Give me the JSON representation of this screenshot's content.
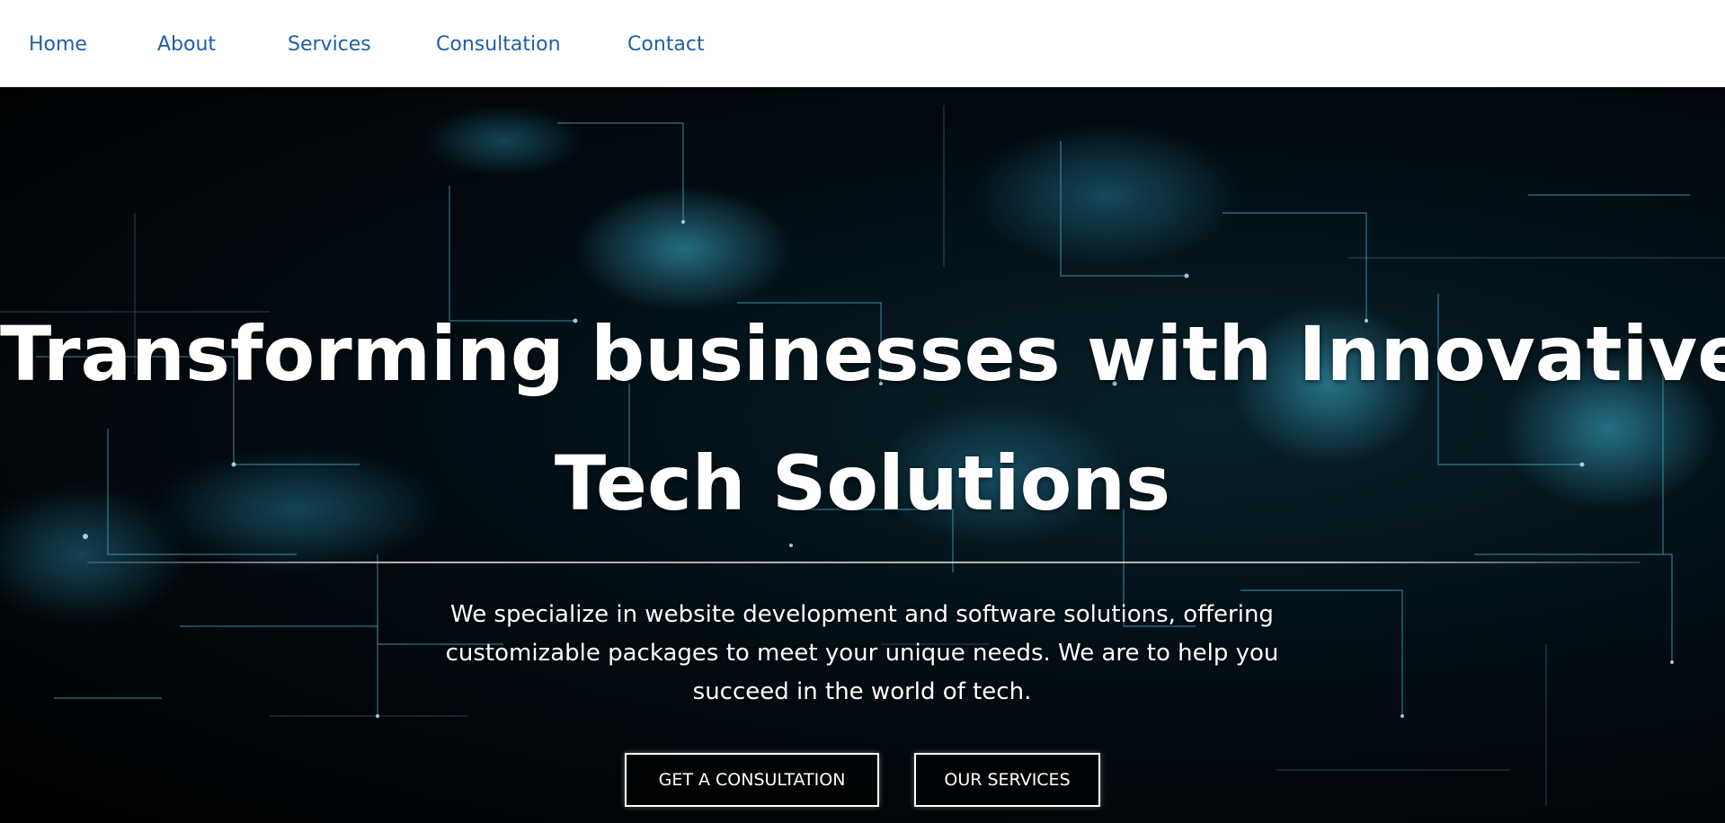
{
  "nav": {
    "items": [
      {
        "label": "Home"
      },
      {
        "label": "About"
      },
      {
        "label": "Services"
      },
      {
        "label": "Consultation"
      },
      {
        "label": "Contact"
      }
    ]
  },
  "hero": {
    "headline_line1": "Transforming businesses with Innovative",
    "headline_line2": "Tech Solutions",
    "tagline": "We specialize in website development and software solutions, offering customizable packages to meet your unique needs. We are to help you succeed in the world of tech.",
    "buttons": {
      "consultation_label": "GET A CONSULTATION",
      "services_label": "OUR SERVICES"
    }
  },
  "colors": {
    "nav_background": "#ffffff",
    "nav_link": "#1f5fa8",
    "hero_background": "#000000",
    "accent_cyan": "#39b6d8",
    "text": "#ffffff"
  },
  "icons": [
    "abstract-tech-network-background"
  ]
}
